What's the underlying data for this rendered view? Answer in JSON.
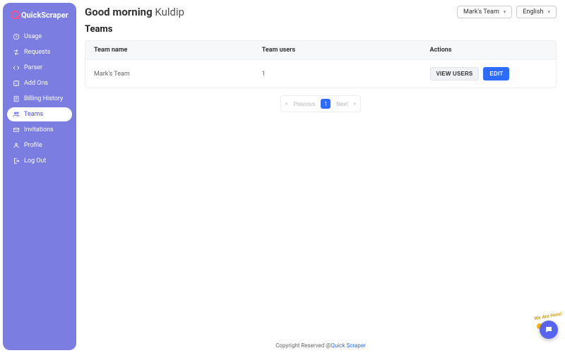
{
  "brand": {
    "name": "QuickScraper"
  },
  "greeting": {
    "prefix": "Good morning",
    "name": "Kuldip"
  },
  "topbar": {
    "team_selector": "Mark's Team",
    "language_selector": "English"
  },
  "sidebar": {
    "items": [
      {
        "label": "Usage"
      },
      {
        "label": "Requests"
      },
      {
        "label": "Parser"
      },
      {
        "label": "Add Ons"
      },
      {
        "label": "Billing History"
      },
      {
        "label": "Teams"
      },
      {
        "label": "Invitations"
      },
      {
        "label": "Profile"
      },
      {
        "label": "Log Out"
      }
    ],
    "active_index": 5
  },
  "page": {
    "title": "Teams",
    "table": {
      "columns": [
        "Team name",
        "Team users",
        "Actions"
      ],
      "rows": [
        {
          "name": "Mark's Team",
          "users": "1"
        }
      ],
      "actions": {
        "view_users": "VIEW USERS",
        "edit": "EDIT"
      }
    },
    "pager": {
      "prev": "Previous",
      "next": "Next",
      "current": "1"
    }
  },
  "footer": {
    "text": "Copyright Reserved @",
    "link": "Quick Scraper"
  },
  "help": {
    "tag": "We Are Here!"
  }
}
